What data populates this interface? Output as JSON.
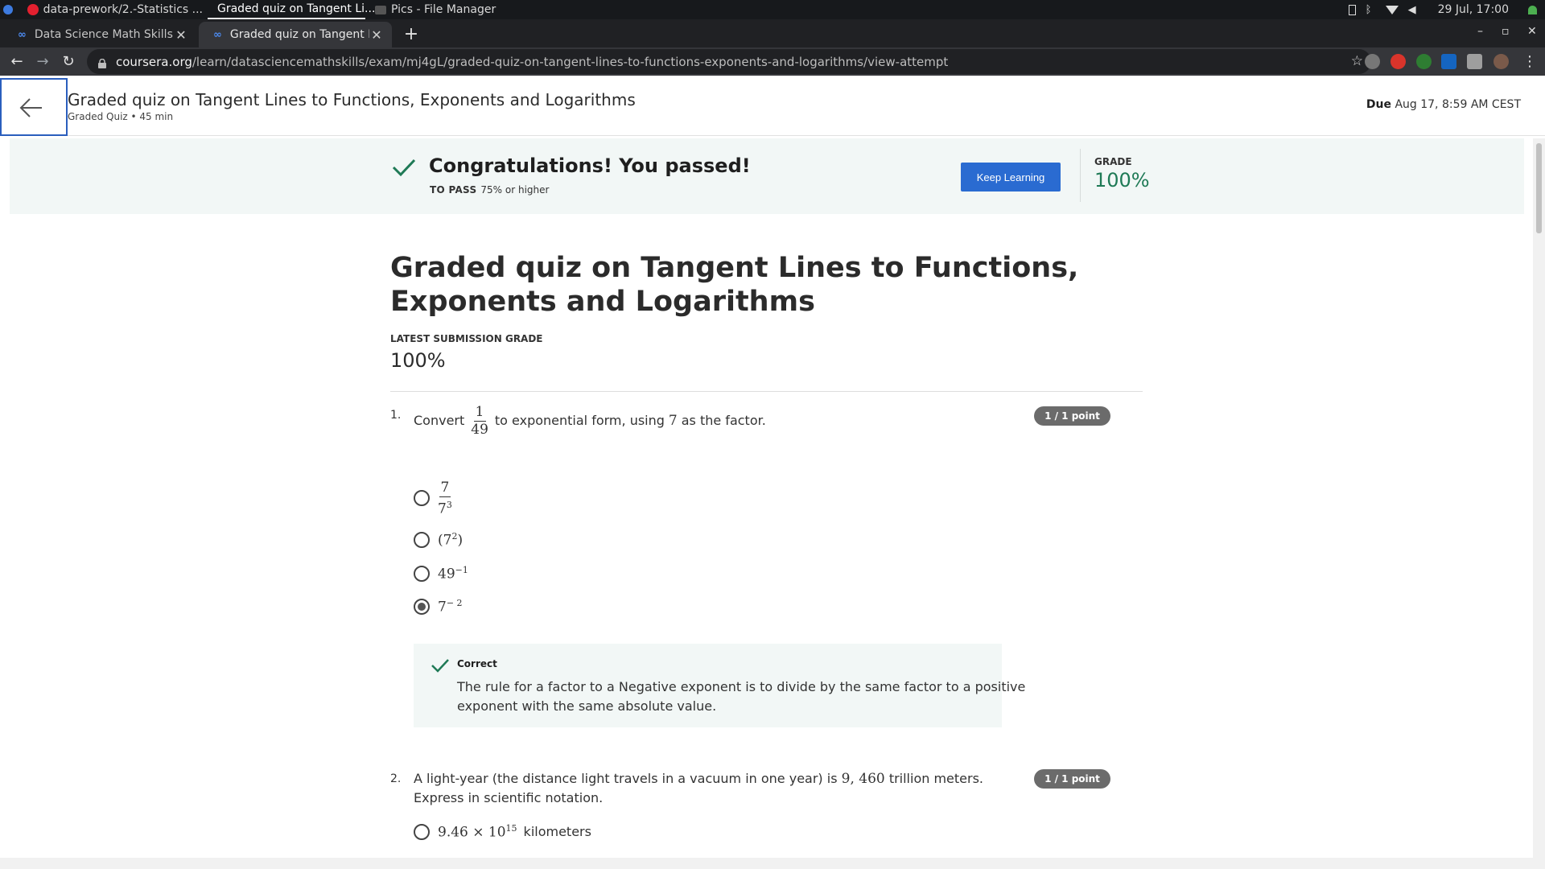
{
  "os": {
    "windows": [
      {
        "label": "data-prework/2.-Statistics ..."
      },
      {
        "label": "Graded quiz on Tangent Li..."
      },
      {
        "label": "Pics - File Manager"
      }
    ],
    "clock": "29 Jul, 17:00"
  },
  "browser": {
    "tabs": [
      {
        "label": "Data Science Math Skills - Fun"
      },
      {
        "label": "Graded quiz on Tangent Line"
      }
    ],
    "url_host": "coursera.org",
    "url_path": "/learn/datasciencemathskills/exam/mj4gL/graded-quiz-on-tangent-lines-to-functions-exponents-and-logarithms/view-attempt"
  },
  "header": {
    "title": "Graded quiz on Tangent Lines to Functions, Exponents and Logarithms",
    "subtitle": "Graded Quiz • 45 min",
    "due_label": "Due",
    "due_value": "Aug 17, 8:59 AM CEST"
  },
  "banner": {
    "message": "Congratulations! You passed!",
    "to_pass_label": "TO PASS",
    "to_pass_value": "75% or higher",
    "button": "Keep Learning",
    "grade_label": "GRADE",
    "grade_value": "100%"
  },
  "main": {
    "title": "Graded quiz on Tangent Lines to Functions, Exponents and Logarithms",
    "submission_label": "LATEST SUBMISSION GRADE",
    "submission_grade": "100%"
  },
  "q1": {
    "number": "1.",
    "text_before": "Convert",
    "frac_num": "1",
    "frac_den": "49",
    "text_mid": "to exponential form, using",
    "factor": "7",
    "text_after": "as the factor.",
    "points": "1 / 1 point",
    "options": [
      {
        "base": "7",
        "den_base": "7",
        "den_exp": "3",
        "checked": false
      },
      {
        "base": "(7",
        "exp": "2",
        "tail": ")",
        "checked": false
      },
      {
        "base": "49",
        "exp": "−1",
        "checked": false
      },
      {
        "base": "7",
        "exp": "− 2",
        "checked": true
      }
    ],
    "feedback_title": "Correct",
    "feedback_text": "The rule for a factor to a Negative exponent is to divide by the same factor to a positive exponent with the same absolute value."
  },
  "q2": {
    "number": "2.",
    "text_before": "A light-year (the distance light travels in a vacuum in one year) is",
    "value": "9, 460",
    "text_after": "trillion meters. Express in scientific notation.",
    "points": "1 / 1 point",
    "option1_math": "9.46 × 10",
    "option1_exp": "15",
    "option1_unit": "kilometers"
  },
  "colors": {
    "accent": "#2a6bd1",
    "pass_green": "#1f7a56",
    "banner_bg": "#f2f7f6",
    "badge_gray": "#6b6b6b"
  }
}
